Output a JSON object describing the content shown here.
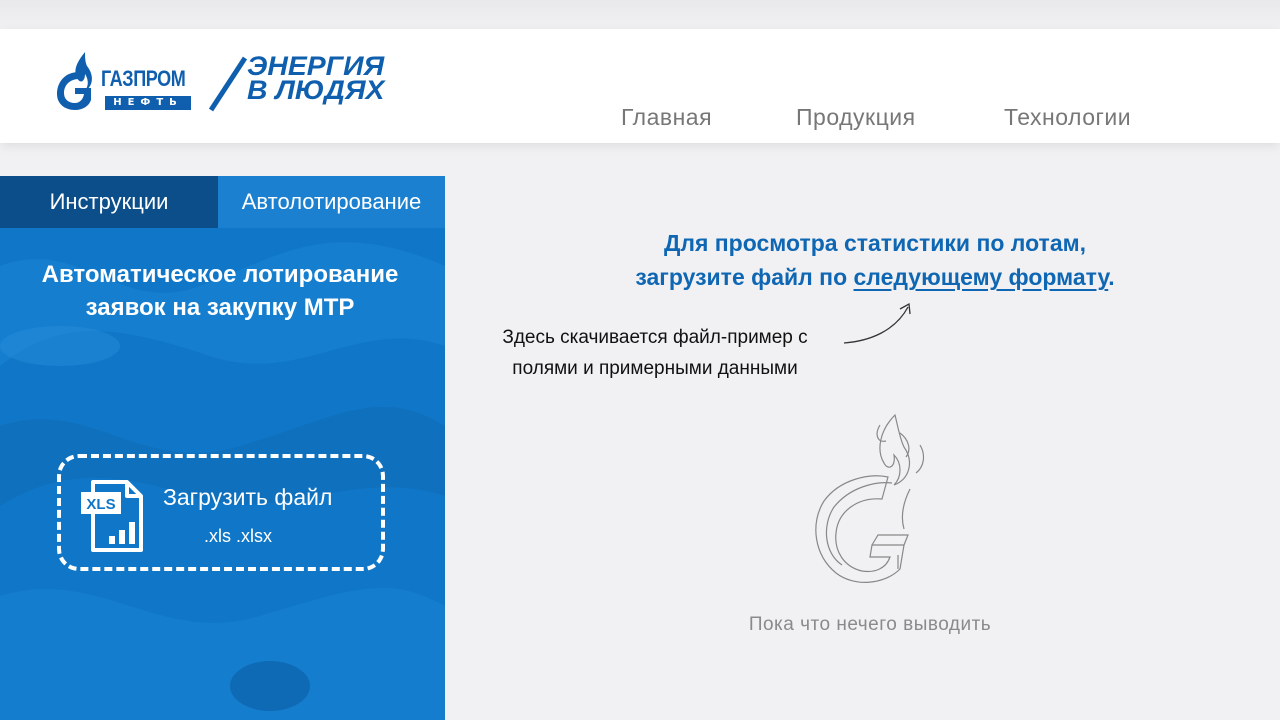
{
  "header": {
    "brand_name": "ГАЗПРОМ",
    "brand_sub": "НЕФТЬ",
    "tagline_line1": "ЭНЕРГИЯ",
    "tagline_line2": "В ЛЮДЯХ",
    "nav": [
      "Главная",
      "Продукция",
      "Технологии"
    ]
  },
  "sidebar": {
    "tabs": [
      {
        "label": "Инструкции",
        "active": false
      },
      {
        "label": "Автолотирование",
        "active": true
      }
    ],
    "title_line1": "Автоматическое лотирование",
    "title_line2": "заявок на закупку МТР",
    "upload": {
      "icon": "xls-file-icon",
      "icon_label": "XLS",
      "label": "Загрузить файл",
      "extensions": ".xls .xlsx"
    }
  },
  "main": {
    "stats_line1": "Для просмотра статистики по лотам,",
    "stats_line2_prefix": "загрузите файл по ",
    "format_link": "следующему формату",
    "stats_line2_suffix": ".",
    "annotation_line1": "Здесь скачивается файл-пример с",
    "annotation_line2": "полями и примерными данными",
    "empty_icon": "gazprom-flame-sketch-icon",
    "empty_text": "Пока что нечего выводить"
  },
  "colors": {
    "brand_blue": "#0f5fae",
    "panel_blue": "#1077c8",
    "tab_dark": "#0c4e8a",
    "link_blue": "#0f67b4"
  }
}
